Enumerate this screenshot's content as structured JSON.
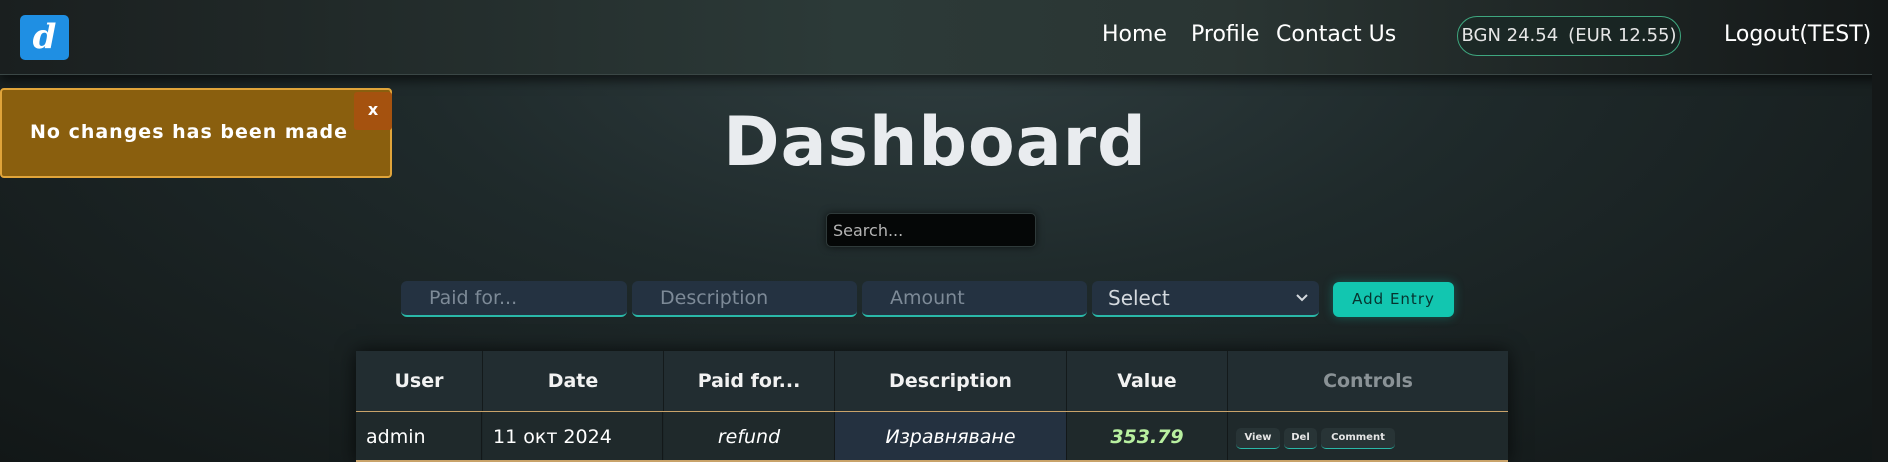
{
  "app": {
    "logo_letter": "d"
  },
  "nav": {
    "home": "Home",
    "profile": "Profile",
    "contact": "Contact Us"
  },
  "balance": {
    "bgn": "BGN 24.54",
    "eur": "(EUR 12.55)"
  },
  "logout_label": "Logout(TEST)",
  "toast": {
    "message": "No changes has been made",
    "close": "x",
    "color": "#8a5f0e"
  },
  "page_title": "Dashboard",
  "search": {
    "placeholder": "Search..."
  },
  "entry_form": {
    "paid_for_placeholder": "Paid for...",
    "description_placeholder": "Description",
    "amount_placeholder": "Amount",
    "select_value": "Select",
    "add_button": "Add Entry",
    "accent": "#12c6b0"
  },
  "table": {
    "headers": [
      "User",
      "Date",
      "Paid for...",
      "Description",
      "Value",
      "Controls"
    ],
    "rows": [
      {
        "user": "admin",
        "date": "11 окт 2024",
        "paid_for": "refund",
        "description": "Изравняване",
        "value": "353.79",
        "controls": [
          "View",
          "Del",
          "Comment"
        ]
      }
    ]
  }
}
